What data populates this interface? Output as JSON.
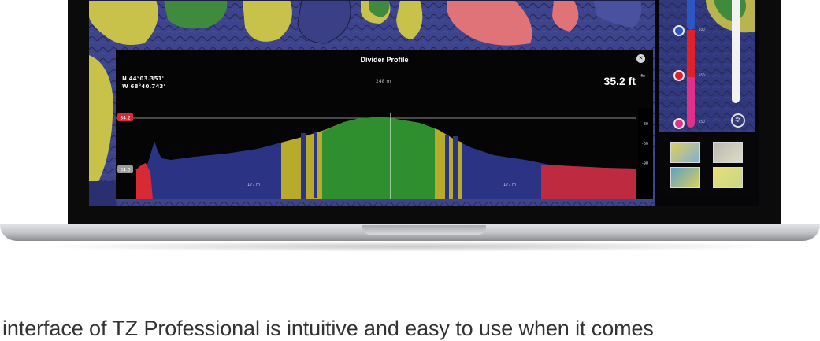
{
  "profile_window": {
    "title": "Divider Profile",
    "close_icon": "close-icon",
    "coord_lat": "N 44°03.351'",
    "coord_lon": "W 68°40.743'",
    "distance_top": "248 m",
    "depth_value": "35.2 ft",
    "depth_unit": "(ft)",
    "marker_top": "84.2",
    "marker_bottom": "34.0",
    "segment_left": "177 m",
    "segment_right": "177 m",
    "axis_ticks": [
      "-30",
      "-60",
      "-90"
    ]
  },
  "side_panel": {
    "scale_ticks": [
      "100",
      "350",
      "250"
    ],
    "layer_thumbnails": [
      "map-layer-1",
      "map-layer-2",
      "map-layer-3",
      "map-layer-4"
    ],
    "settings_icon": "gear-icon"
  },
  "caption": "interface of TZ Professional is intuitive and easy to use when it comes",
  "colors": {
    "shallow_green": "#2f8f2e",
    "mid_yellow": "#b8aa2a",
    "deep_blue": "#2b3385",
    "land_red": "#d82a34",
    "scale_blue": "#2c55c8",
    "scale_red": "#e0212b",
    "scale_pink": "#e0318a"
  }
}
